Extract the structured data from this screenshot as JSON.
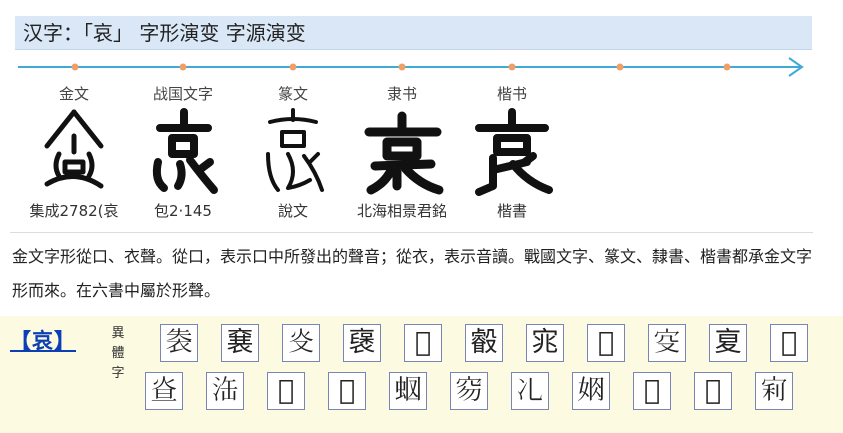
{
  "title": "汉字：「哀」 字形演变 字源演变",
  "stages": [
    {
      "name": "金文",
      "source": "集成2782(哀"
    },
    {
      "name": "战国文字",
      "source": "包2·145"
    },
    {
      "name": "篆文",
      "source": "說文"
    },
    {
      "name": "隶书",
      "source": "北海相景君銘"
    },
    {
      "name": "楷书",
      "source": "楷書"
    }
  ],
  "explanation": "金文字形從口、衣聲。從口，表示口中所發出的聲音；從衣，表示音讀。戰國文字、篆文、隸書、楷書都承金文字形而來。在六書中屬於形聲。",
  "variants_section": {
    "head_char": "【哀】",
    "label": "異體字",
    "row1": [
      "𧙍",
      "㐮",
      "𤆌",
      "襃",
      "𧞤",
      "㲊",
      "宨",
      "𡨝",
      "𡧔",
      "㚆",
      "𢗳"
    ],
    "row2": [
      "𤇁",
      "𣳬",
      "𡨐",
      "𡉋",
      "𧉫",
      "𥤽",
      "𠖬",
      "𡜃",
      "𡧉",
      "𢤥",
      "𡨖"
    ]
  },
  "colors": {
    "timeline": "#3fa9d8",
    "timeline_dots": "#f0a066",
    "title_bar": "#d9e7f7",
    "variant_panel": "#fcfbe2",
    "head_char": "#0b3fb3"
  }
}
